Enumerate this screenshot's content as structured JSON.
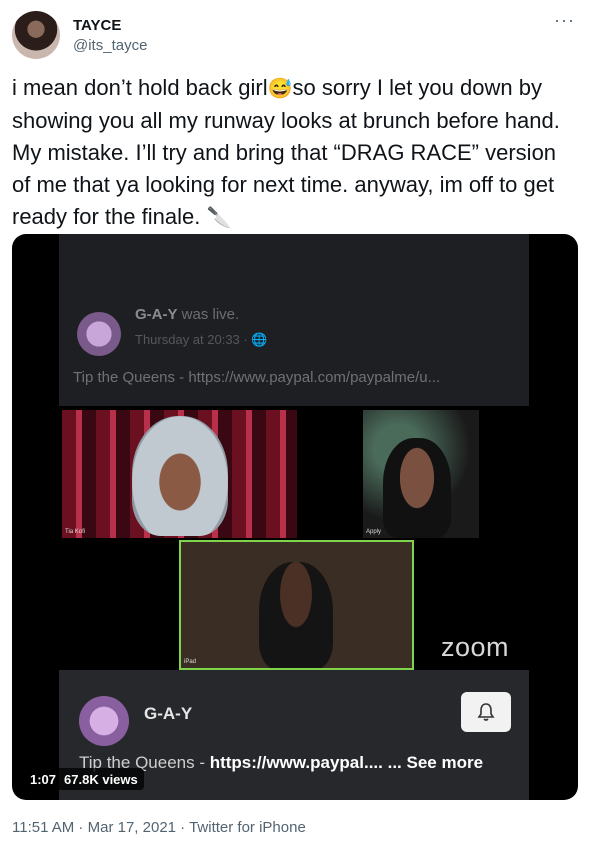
{
  "user": {
    "name": "TAYCE",
    "handle": "@its_tayce"
  },
  "more_label": "···",
  "tweet": {
    "text_part1": "i mean don’t hold back girl",
    "emoji_1": "😅",
    "text_part2": "so sorry I let you down by showing you all my runway looks at brunch before hand. My mistake. I’ll try and bring that “DRAG RACE” version of me that ya looking for next time. anyway, im off to get ready for the finale.",
    "emoji_2": "🔪"
  },
  "video": {
    "fb_header": {
      "page_name": "G-A-Y",
      "status": "was live.",
      "time": "Thursday at 20:33 · 🌐",
      "tip_text": "Tip the Queens - https://www.paypal.com/paypalme/u..."
    },
    "tiles": [
      {
        "label": "Tia Kofi"
      },
      {
        "label": "Apply"
      },
      {
        "label": "iPad"
      }
    ],
    "zoom_logo": "zoom",
    "fb_footer": {
      "page_name": "G-A-Y",
      "tip_text": "Tip the Queens - ",
      "tip_link": "https://www.paypal.... ... See more"
    },
    "duration": "1:07",
    "views": "67.8K views"
  },
  "footer": {
    "time": "11:51 AM",
    "date": "Mar 17, 2021",
    "source": "Twitter for iPhone"
  }
}
